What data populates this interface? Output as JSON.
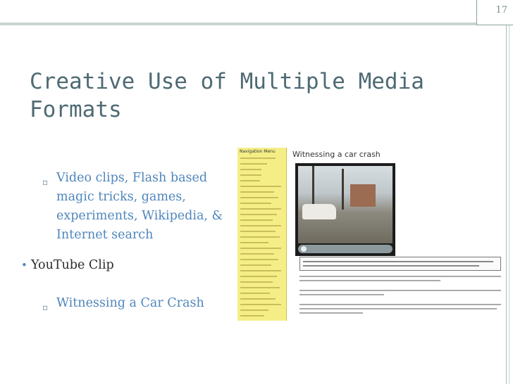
{
  "slide": {
    "page_number": "17",
    "title_line1": "Creative Use of Multiple Media",
    "title_line2": "Formats"
  },
  "bullets": {
    "item1_marker": "▫",
    "item1_lines": [
      "Video clips, Flash based",
      "magic tricks, games,",
      "experiments, Wikipedia, &",
      "Internet search"
    ],
    "item2_marker": "•",
    "item2": "YouTube Clip",
    "item3_marker": "▫",
    "item3": "Witnessing a Car Crash"
  },
  "screenshot": {
    "nav_title": "Navigation Menu",
    "video_title": "Witnessing a car crash"
  },
  "colors": {
    "title": "#4e6a73",
    "sub_bullet_text": "#4f86bb",
    "nav_menu_bg": "#f5ee86"
  }
}
